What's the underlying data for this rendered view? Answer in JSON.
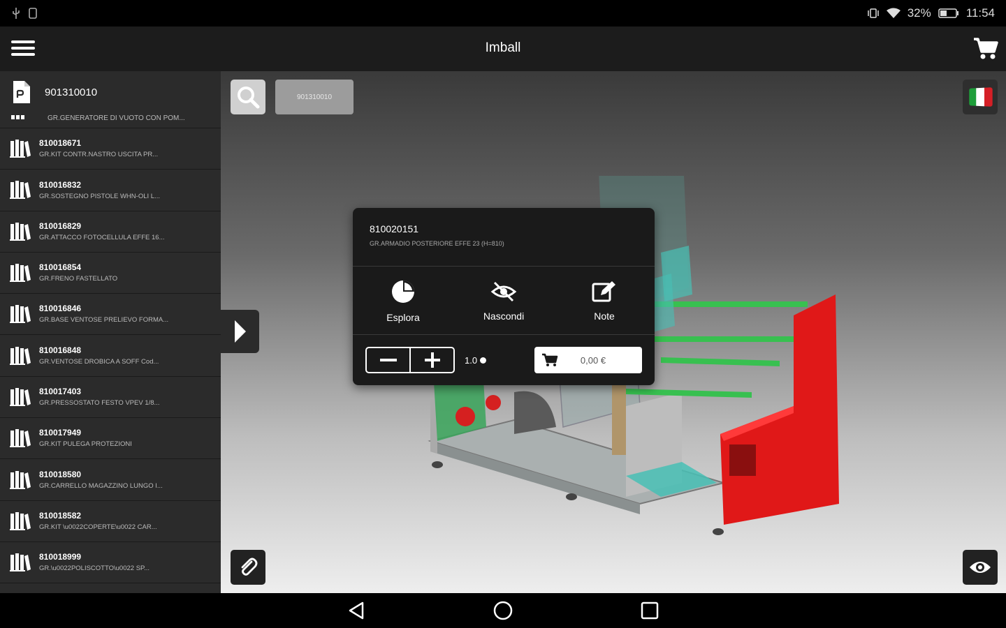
{
  "status_bar": {
    "battery": "32%",
    "time": "11:54",
    "icons": [
      "usb-icon",
      "sim-icon",
      "vibrate-icon",
      "wifi-icon",
      "battery-icon"
    ]
  },
  "app_bar": {
    "title": "Imball",
    "menu_icon": "hamburger-menu-icon",
    "cart_icon": "cart-icon"
  },
  "sidebar": {
    "header": {
      "code": "901310010",
      "icon": "document-icon"
    },
    "partial_item": {
      "desc": "GR.GENERATORE DI VUOTO CON POM..."
    },
    "items": [
      {
        "code": "810018671",
        "desc": "GR.KIT CONTR.NASTRO USCITA PR..."
      },
      {
        "code": "810016832",
        "desc": "GR.SOSTEGNO PISTOLE WHN-OLI L..."
      },
      {
        "code": "810016829",
        "desc": "GR.ATTACCO FOTOCELLULA EFFE 16..."
      },
      {
        "code": "810016854",
        "desc": "GR.FRENO FASTELLATO"
      },
      {
        "code": "810016846",
        "desc": "GR.BASE VENTOSE PRELIEVO FORMA..."
      },
      {
        "code": "810016848",
        "desc": "GR.VENTOSE DROBICA A SOFF Cod..."
      },
      {
        "code": "810017403",
        "desc": "GR.PRESSOSTATO FESTO VPEV 1/8..."
      },
      {
        "code": "810017949",
        "desc": "GR.KIT PULEGA PROTEZIONI"
      },
      {
        "code": "810018580",
        "desc": "GR.CARRELLO MAGAZZINO LUNGO I..."
      },
      {
        "code": "810018582",
        "desc": "GR.KIT \\u0022COPERTE\\u0022 CAR..."
      },
      {
        "code": "810018999",
        "desc": "GR.\\u0022POLISCOTTO\\u0022 SP..."
      }
    ]
  },
  "viewport": {
    "search_chip": "901310010",
    "flag": "italy-flag-icon"
  },
  "popup": {
    "code": "810020151",
    "desc": "GR.ARMADIO POSTERIORE EFFE 23 (H=810)",
    "actions": [
      {
        "label": "Esplora",
        "icon": "pie-chart-icon"
      },
      {
        "label": "Nascondi",
        "icon": "eye-slash-icon"
      },
      {
        "label": "Note",
        "icon": "edit-note-icon"
      }
    ],
    "quantity": "1.0",
    "price": "0,00 €"
  },
  "colors": {
    "appbar_bg": "#1c1c1c",
    "sidebar_bg": "#2b2b2b",
    "popup_bg": "#1a1a1a",
    "machine_red": "#e01818",
    "machine_green": "#3cb043"
  }
}
